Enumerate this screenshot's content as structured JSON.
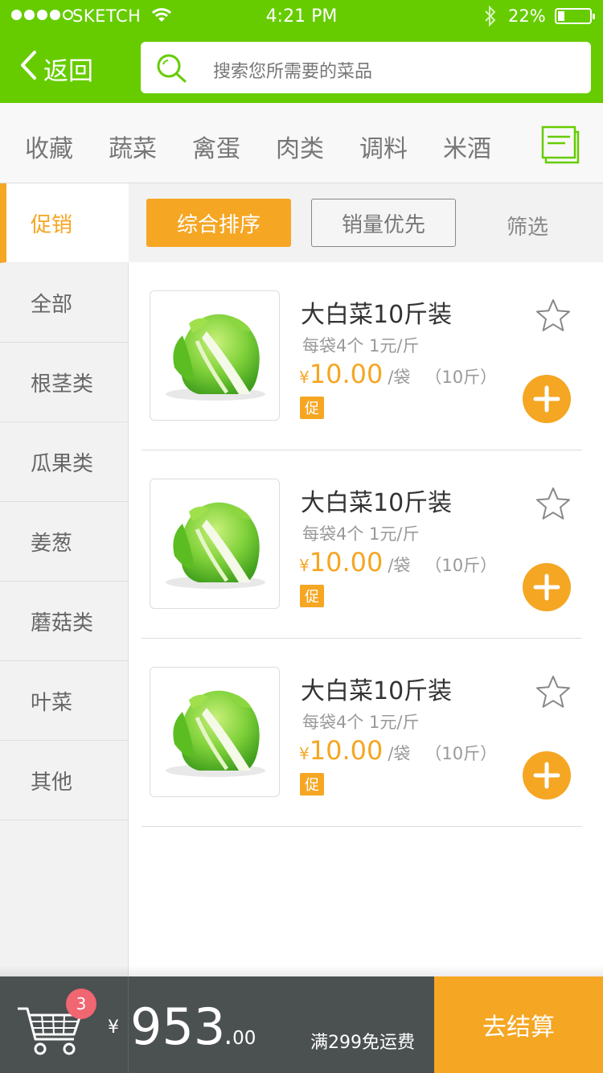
{
  "status_bar": {
    "carrier": "SKETCH",
    "time": "4:21 PM",
    "battery": "22%",
    "battery_level": 0.22
  },
  "header": {
    "back_label": "返回",
    "search_placeholder": "搜索您所需要的菜品"
  },
  "categories": [
    "收藏",
    "蔬菜",
    "禽蛋",
    "肉类",
    "调料",
    "米酒"
  ],
  "sidebar": {
    "items": [
      "促销",
      "全部",
      "根茎类",
      "瓜果类",
      "姜葱",
      "蘑菇类",
      "叶菜",
      "其他"
    ],
    "active": "促销"
  },
  "sort": {
    "primary": "综合排序",
    "sales": "销量优先",
    "filter": "筛选"
  },
  "products": [
    {
      "name": "大白菜10斤装",
      "spec": "每袋4个 1元/斤",
      "currency": "¥",
      "price": "10.00",
      "unit": "/袋",
      "weight": "（10斤）",
      "badge": "促"
    },
    {
      "name": "大白菜10斤装",
      "spec": "每袋4个 1元/斤",
      "currency": "¥",
      "price": "10.00",
      "unit": "/袋",
      "weight": "（10斤）",
      "badge": "促"
    },
    {
      "name": "大白菜10斤装",
      "spec": "每袋4个 1元/斤",
      "currency": "¥",
      "price": "10.00",
      "unit": "/袋",
      "weight": "（10斤）",
      "badge": "促"
    }
  ],
  "cart": {
    "count": "3",
    "currency": "¥",
    "total_int": "953",
    "total_dot": ".",
    "total_dec": "00",
    "free_shipping": "满299免运费",
    "checkout_label": "去结算"
  },
  "colors": {
    "brand_green": "#66cc00",
    "accent_orange": "#f5a623",
    "badge_red": "#f06671",
    "cart_bar": "#4b5051"
  },
  "icons": [
    "wifi-icon",
    "bluetooth-icon",
    "battery-icon",
    "back-chevron-icon",
    "search-icon",
    "list-view-icon",
    "star-icon",
    "plus-icon",
    "cart-icon"
  ]
}
